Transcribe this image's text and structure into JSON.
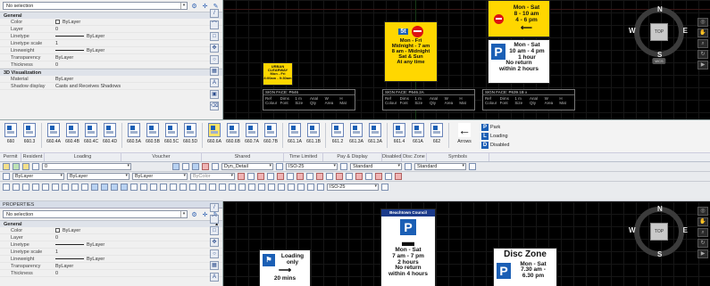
{
  "properties_top": {
    "selection": "No selection",
    "sections": {
      "general": "General",
      "visualization": "3D Visualization"
    },
    "general_rows": [
      {
        "key": "Color",
        "value": "ByLayer",
        "kind": "color"
      },
      {
        "key": "Layer",
        "value": "0",
        "kind": "text"
      },
      {
        "key": "Linetype",
        "value": "ByLayer",
        "kind": "line"
      },
      {
        "key": "Linetype scale",
        "value": "1",
        "kind": "text"
      },
      {
        "key": "Lineweight",
        "value": "ByLayer",
        "kind": "line"
      },
      {
        "key": "Transparency",
        "value": "ByLayer",
        "kind": "text"
      },
      {
        "key": "Thickness",
        "value": "0",
        "kind": "text"
      }
    ],
    "viz_rows": [
      {
        "key": "Material",
        "value": "ByLayer"
      },
      {
        "key": "Shadow display",
        "value": "Casts and Receives Shadows"
      }
    ]
  },
  "properties_bottom": {
    "title": "PROPERTIES",
    "selection": "No selection",
    "section": "General",
    "rows": [
      {
        "key": "Color",
        "value": "ByLayer",
        "kind": "color"
      },
      {
        "key": "Layer",
        "value": "0",
        "kind": "text"
      },
      {
        "key": "Linetype",
        "value": "ByLayer",
        "kind": "line"
      },
      {
        "key": "Linetype scale",
        "value": "1",
        "kind": "text"
      },
      {
        "key": "Lineweight",
        "value": "ByLayer",
        "kind": "line"
      },
      {
        "key": "Transparency",
        "value": "ByLayer",
        "kind": "text"
      },
      {
        "key": "Thickness",
        "value": "0",
        "kind": "text"
      }
    ]
  },
  "signs_top": {
    "school_sign": [
      "URBAN",
      "CLEARWAY",
      "Mon - Fri",
      "8:00am - 9:30am"
    ],
    "center_sign": {
      "badge": "5t",
      "lines": [
        "Mon - Fri",
        "Midnight - 7 am",
        "8 am - Midnight",
        "Sat & Sun",
        "At any time"
      ]
    },
    "right_sign_top": [
      "Mon - Sat",
      "8 - 10 am",
      "4 - 6 pm"
    ],
    "right_sign_bottom": [
      "Mon - Sat",
      "10 am - 4 pm",
      "1 hour",
      "No return",
      "within 2 hours"
    ],
    "p_letter": "P",
    "captions": [
      {
        "title": "SIGN FACE: P646",
        "cells": [
          "Ref",
          "Dims",
          "1 m",
          "Arial",
          "W",
          "H",
          "Colour",
          "Font",
          "Size",
          "Qty",
          "Area",
          "Mat"
        ]
      },
      {
        "title": "SIGN FACE: P646.2A",
        "cells": [
          "Ref",
          "Dims",
          "1 m",
          "Arial",
          "W",
          "H",
          "Colour",
          "Font",
          "Size",
          "Qty",
          "Area",
          "Mat"
        ]
      },
      {
        "title": "SIGN FACE: P639.1B x",
        "cells": [
          "Ref",
          "Dims",
          "1 m",
          "Arial",
          "W",
          "H",
          "Colour",
          "Font",
          "Size",
          "Qty",
          "Area",
          "Mat"
        ]
      }
    ]
  },
  "signs_bottom": {
    "council": "Beachtown Council",
    "bus_lines": [
      "Mon - Sat",
      "7 am - 7 pm",
      "2 hours",
      "No return",
      "within 4 hours"
    ],
    "loading_lines": [
      "Loading",
      "only"
    ],
    "loading_time": "20 mins",
    "disc_title": "Disc Zone",
    "disc_lines": [
      "Mon - Sat",
      "7.30 am -",
      "6.30 pm"
    ],
    "p_letter": "P"
  },
  "navcube": {
    "top_label": "TOP",
    "n": "N",
    "s": "S",
    "e": "E",
    "w": "W",
    "wcs": "WCS"
  },
  "ribbon": {
    "tiles": [
      {
        "label": "660",
        "style": "white"
      },
      {
        "label": "660.3",
        "style": "white"
      },
      {
        "label": "660.4A",
        "style": "white"
      },
      {
        "label": "660.4B",
        "style": "white"
      },
      {
        "label": "660.4C",
        "style": "white"
      },
      {
        "label": "660.4D",
        "style": "white"
      },
      {
        "label": "660.5A",
        "style": "white"
      },
      {
        "label": "660.5B",
        "style": "white"
      },
      {
        "label": "660.5C",
        "style": "white"
      },
      {
        "label": "660.5D",
        "style": "white"
      },
      {
        "label": "660.6A",
        "style": "yellow"
      },
      {
        "label": "660.6B",
        "style": "white"
      },
      {
        "label": "660.7A",
        "style": "white"
      },
      {
        "label": "660.7B",
        "style": "white"
      },
      {
        "label": "661.1A",
        "style": "white"
      },
      {
        "label": "661.1B",
        "style": "white"
      },
      {
        "label": "661.2",
        "style": "white"
      },
      {
        "label": "661.3A",
        "style": "white"
      },
      {
        "label": "661.3A",
        "style": "white"
      },
      {
        "label": "661.4",
        "style": "white"
      },
      {
        "label": "661A",
        "style": "white"
      },
      {
        "label": "662",
        "style": "white"
      }
    ],
    "arrows_label": "Arrows",
    "symbols": [
      {
        "icon": "P",
        "label": "Park"
      },
      {
        "icon": "L",
        "label": "Loading"
      },
      {
        "icon": "D",
        "label": "Disabled"
      }
    ],
    "groups": [
      {
        "label": "Permit",
        "w": 22
      },
      {
        "label": "Resident",
        "w": 26
      },
      {
        "label": "Loading",
        "w": 90
      },
      {
        "label": "Voucher",
        "w": 90
      },
      {
        "label": "Shared",
        "w": 90
      },
      {
        "label": "Time Limited",
        "w": 44
      },
      {
        "label": "Pay & Display",
        "w": 70
      },
      {
        "label": "Disabled",
        "w": 24
      },
      {
        "label": "Disc Zone",
        "w": 24
      },
      {
        "label": "Symbols",
        "w": 70
      }
    ]
  },
  "toolbar1": {
    "layer": "0",
    "dim_style": "Dyn_Detail",
    "text_scale": "ISO-25",
    "text_style": "Standard",
    "table_style": "Standard"
  },
  "toolbar2": {
    "color": "ByLayer",
    "linetype": "ByLayer",
    "lineweight": "ByLayer",
    "plotstyle": "ByColor"
  },
  "toolbar3": {
    "dim_scale": "ISO-25"
  }
}
